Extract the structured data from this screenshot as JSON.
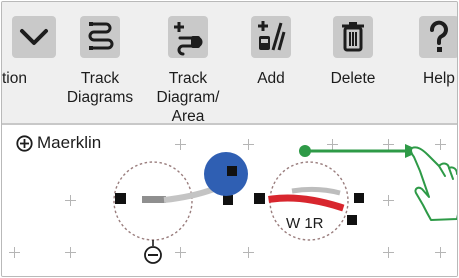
{
  "toolbar": {
    "items": [
      {
        "label": "",
        "icon": "chevron-down-icon"
      },
      {
        "label": "tion",
        "icon": ""
      },
      {
        "label": "Track\nDiagrams",
        "icon": "track-diagrams-icon"
      },
      {
        "label": "Track\nDiagram/\nArea",
        "icon": "track-diagram-area-icon"
      },
      {
        "label": "Add",
        "icon": "add-accessory-icon"
      },
      {
        "label": "Delete",
        "icon": "trash-icon"
      },
      {
        "label": "Help",
        "icon": "question-icon"
      }
    ]
  },
  "canvas": {
    "layout_name": "Maerklin",
    "turnout_label": "W 1R",
    "colors": {
      "selected_fill": "#2f5fb3",
      "turnout_route": "#d8262e",
      "track": "#9a9a9a",
      "arrow": "#2e9a47"
    }
  }
}
